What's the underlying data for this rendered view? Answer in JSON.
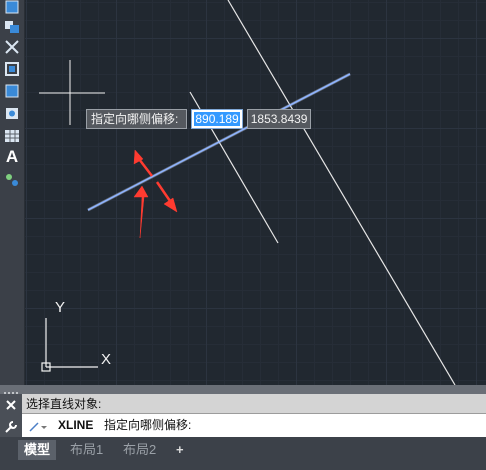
{
  "toolbar": {
    "tools": [
      "shape-tool-icon",
      "block-tool-icon",
      "trim-icon",
      "region-icon",
      "hatch-icon",
      "camera-icon",
      "table-icon",
      "text-tool-icon",
      "point-tool-icon"
    ],
    "text_glyph": "A"
  },
  "ucs": {
    "x_label": "X",
    "y_label": "Y"
  },
  "prompt": {
    "label": "指定向哪侧偏移:",
    "value_x": "890.189",
    "value_y": "1853.8439"
  },
  "command": {
    "history": "选择直线对象:",
    "input_prefix": "XLINE",
    "input_text": "指定向哪侧偏移:"
  },
  "tabs": [
    "模型",
    "布局1",
    "布局2",
    "+"
  ],
  "colors": {
    "canvas_bg": "#212830",
    "selected_line": "#a8c8ff",
    "annotation_arrow": "#ff3b30"
  }
}
